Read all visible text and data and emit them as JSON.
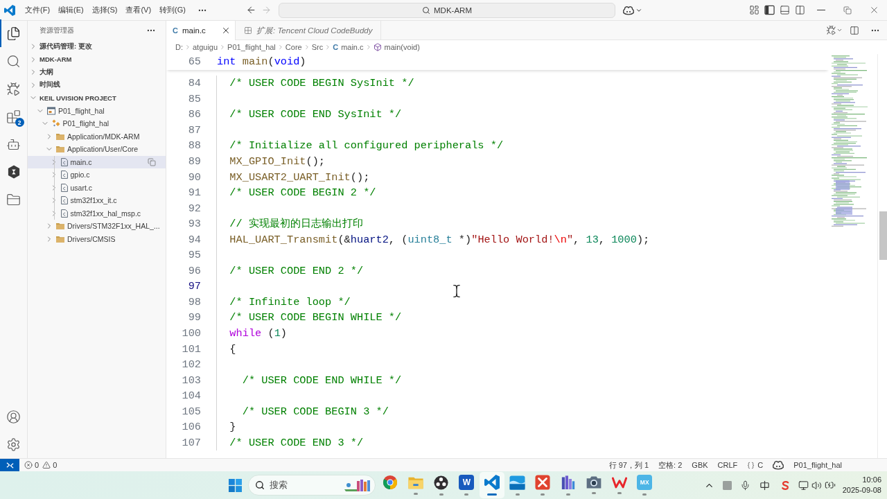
{
  "title_bar": {
    "menus": [
      "文件(F)",
      "编辑(E)",
      "选择(S)",
      "查看(V)",
      "转到(G)"
    ],
    "command_center": "MDK-ARM"
  },
  "activity_bar": {
    "items": [
      {
        "kind": "explorer",
        "selected": true
      },
      {
        "kind": "search",
        "selected": false
      },
      {
        "kind": "run-debug",
        "selected": false
      },
      {
        "kind": "extensions",
        "selected": false,
        "badge": "2"
      },
      {
        "kind": "assistant",
        "selected": false
      },
      {
        "kind": "codebuddy",
        "selected": false
      },
      {
        "kind": "project",
        "selected": false
      }
    ]
  },
  "sidebar": {
    "title": "资源管理器",
    "sections": [
      {
        "label": "源代码管理: 更改",
        "expanded": false
      },
      {
        "label": "MDK-ARM",
        "expanded": false
      },
      {
        "label": "大纲",
        "expanded": false
      },
      {
        "label": "时间线",
        "expanded": false
      },
      {
        "label": "KEIL UVISION PROJECT",
        "expanded": true,
        "tree": [
          {
            "label": "P01_flight_hal",
            "kind": "project",
            "expanded": true,
            "selected": false,
            "children": [
              {
                "label": "P01_flight_hal",
                "kind": "target",
                "expanded": true,
                "selected": false,
                "children": [
                  {
                    "label": "Application/MDK-ARM",
                    "kind": "folder",
                    "expanded": false,
                    "selected": false
                  },
                  {
                    "label": "Application/User/Core",
                    "kind": "folder",
                    "expanded": true,
                    "selected": false,
                    "children": [
                      {
                        "label": "main.c",
                        "kind": "file",
                        "expanded": false,
                        "selected": true
                      },
                      {
                        "label": "gpio.c",
                        "kind": "file",
                        "expanded": false,
                        "selected": false
                      },
                      {
                        "label": "usart.c",
                        "kind": "file",
                        "expanded": false,
                        "selected": false
                      },
                      {
                        "label": "stm32f1xx_it.c",
                        "kind": "file",
                        "expanded": false,
                        "selected": false
                      },
                      {
                        "label": "stm32f1xx_hal_msp.c",
                        "kind": "file",
                        "expanded": false,
                        "selected": false
                      }
                    ]
                  },
                  {
                    "label": "Drivers/STM32F1xx_HAL_...",
                    "kind": "folder",
                    "expanded": false,
                    "selected": false
                  },
                  {
                    "label": "Drivers/CMSIS",
                    "kind": "folder",
                    "expanded": false,
                    "selected": false
                  }
                ]
              }
            ]
          }
        ]
      }
    ]
  },
  "editor": {
    "tabs": [
      {
        "label": "main.c",
        "kind": "c-file",
        "icon_glyph": "C",
        "selected": true
      },
      {
        "label": "扩展: Tencent Cloud CodeBuddy",
        "kind": "preview",
        "selected": false
      }
    ],
    "breadcrumb": [
      {
        "label": "D:",
        "kind": "path"
      },
      {
        "label": "atguigu",
        "kind": "path"
      },
      {
        "label": "P01_flight_hal",
        "kind": "path"
      },
      {
        "label": "Core",
        "kind": "path"
      },
      {
        "label": "Src",
        "kind": "path"
      },
      {
        "label": "main.c",
        "kind": "c-file",
        "icon_glyph": "C"
      },
      {
        "label": "main(void)",
        "kind": "function"
      }
    ],
    "sticky_line": {
      "number": "65",
      "tokens": [
        {
          "kind": "keyword",
          "text": "int"
        },
        {
          "kind": "function",
          "text": " main"
        },
        {
          "kind": "plain",
          "text": "("
        },
        {
          "kind": "keyword",
          "text": "void"
        },
        {
          "kind": "plain",
          "text": ")"
        }
      ]
    },
    "lines": [
      {
        "number": "84",
        "current": false,
        "tokens": [
          {
            "kind": "comment",
            "text": "  /* USER CODE BEGIN SysInit */"
          }
        ]
      },
      {
        "number": "85",
        "current": false
      },
      {
        "number": "86",
        "current": false,
        "tokens": [
          {
            "kind": "comment",
            "text": "  /* USER CODE END SysInit */"
          }
        ]
      },
      {
        "number": "87",
        "current": false
      },
      {
        "number": "88",
        "current": false,
        "tokens": [
          {
            "kind": "comment",
            "text": "  /* Initialize all configured peripherals */"
          }
        ]
      },
      {
        "number": "89",
        "current": false,
        "tokens": [
          {
            "kind": "function",
            "text": "  MX_GPIO_Init"
          },
          {
            "kind": "plain",
            "text": "();"
          }
        ]
      },
      {
        "number": "90",
        "current": false,
        "tokens": [
          {
            "kind": "function",
            "text": "  MX_USART2_UART_Init"
          },
          {
            "kind": "plain",
            "text": "();"
          }
        ]
      },
      {
        "number": "91",
        "current": false,
        "tokens": [
          {
            "kind": "comment",
            "text": "  /* USER CODE BEGIN 2 */"
          }
        ]
      },
      {
        "number": "92",
        "current": false
      },
      {
        "number": "93",
        "current": false,
        "tokens": [
          {
            "kind": "comment",
            "text": "  // 实现最初的日志输出打印"
          }
        ]
      },
      {
        "number": "94",
        "current": false,
        "tokens": [
          {
            "kind": "function",
            "text": "  HAL_UART_Transmit"
          },
          {
            "kind": "plain",
            "text": "(&"
          },
          {
            "kind": "variable",
            "text": "huart2"
          },
          {
            "kind": "plain",
            "text": ", ("
          },
          {
            "kind": "type",
            "text": "uint8_t"
          },
          {
            "kind": "plain",
            "text": " *)"
          },
          {
            "kind": "string",
            "text": "\"Hello World!"
          },
          {
            "kind": "escape",
            "text": "\\n"
          },
          {
            "kind": "string",
            "text": "\""
          },
          {
            "kind": "plain",
            "text": ", "
          },
          {
            "kind": "number",
            "text": "13"
          },
          {
            "kind": "plain",
            "text": ", "
          },
          {
            "kind": "number",
            "text": "1000"
          },
          {
            "kind": "plain",
            "text": ");"
          }
        ]
      },
      {
        "number": "95",
        "current": false
      },
      {
        "number": "96",
        "current": false,
        "tokens": [
          {
            "kind": "comment",
            "text": "  /* USER CODE END 2 */"
          }
        ]
      },
      {
        "number": "97",
        "current": true
      },
      {
        "number": "98",
        "current": false,
        "tokens": [
          {
            "kind": "comment",
            "text": "  /* Infinite loop */"
          }
        ]
      },
      {
        "number": "99",
        "current": false,
        "tokens": [
          {
            "kind": "comment",
            "text": "  /* USER CODE BEGIN WHILE */"
          }
        ]
      },
      {
        "number": "100",
        "current": false,
        "tokens": [
          {
            "kind": "control",
            "text": "  while"
          },
          {
            "kind": "plain",
            "text": " ("
          },
          {
            "kind": "number",
            "text": "1"
          },
          {
            "kind": "plain",
            "text": ")"
          }
        ]
      },
      {
        "number": "101",
        "current": false,
        "tokens": [
          {
            "kind": "plain",
            "text": "  {"
          }
        ]
      },
      {
        "number": "102",
        "current": false
      },
      {
        "number": "103",
        "current": false,
        "tokens": [
          {
            "kind": "comment",
            "text": "    /* USER CODE END WHILE */"
          }
        ]
      },
      {
        "number": "104",
        "current": false
      },
      {
        "number": "105",
        "current": false,
        "tokens": [
          {
            "kind": "comment",
            "text": "    /* USER CODE BEGIN 3 */"
          }
        ]
      },
      {
        "number": "106",
        "current": false,
        "tokens": [
          {
            "kind": "plain",
            "text": "  }"
          }
        ]
      },
      {
        "number": "107",
        "current": false,
        "tokens": [
          {
            "kind": "comment",
            "text": "  /* USER CODE END 3 */"
          }
        ]
      }
    ]
  },
  "status_bar": {
    "problems": {
      "errors": "0",
      "warnings": "0"
    },
    "items": [
      "行 97，列 1",
      "空格: 2",
      "GBK",
      "CRLF"
    ],
    "language": "C",
    "project": "P01_flight_hal"
  },
  "taskbar": {
    "search": {
      "placeholder": "搜索"
    },
    "apps": [
      {
        "kind": "chrome",
        "open": false,
        "selected": false
      },
      {
        "kind": "file-explorer",
        "open": true,
        "selected": false
      },
      {
        "kind": "obs",
        "open": true,
        "selected": false
      },
      {
        "kind": "word",
        "glyph": "W",
        "open": true,
        "selected": false
      },
      {
        "kind": "vscode",
        "open": true,
        "selected": true
      },
      {
        "kind": "landscape",
        "open": true,
        "selected": false
      },
      {
        "kind": "red-tile",
        "open": true,
        "selected": false
      },
      {
        "kind": "books",
        "open": true,
        "selected": false
      },
      {
        "kind": "camera",
        "open": true,
        "selected": false
      },
      {
        "kind": "wps",
        "open": true,
        "selected": false
      },
      {
        "kind": "mx",
        "glyph": "MX",
        "open": true,
        "selected": false
      }
    ],
    "clock": {
      "time": "10:06",
      "date": "2025-09-08"
    }
  }
}
